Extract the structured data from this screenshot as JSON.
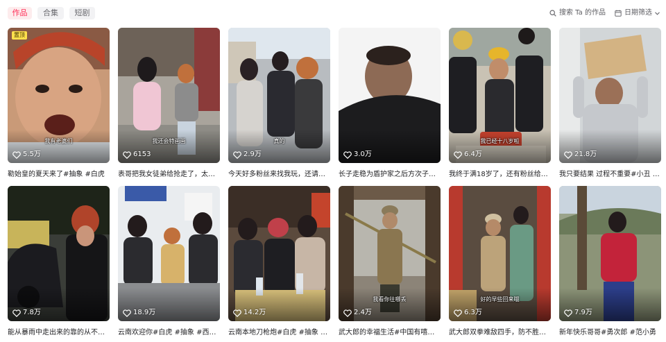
{
  "tabs": [
    {
      "label": "作品",
      "active": true
    },
    {
      "label": "合集",
      "active": false
    },
    {
      "label": "短剧",
      "active": false
    }
  ],
  "toolbar": {
    "search_label": "搜索 Ta 的作品",
    "search_icon": "search-icon",
    "date_filter_label": "日期筛选",
    "date_icon": "calendar-icon",
    "dropdown_icon": "chevron-down-icon"
  },
  "colors": {
    "accent": "#fe2c55",
    "pin_badge": "#ffe14d"
  },
  "videos": [
    {
      "pinned": true,
      "pin_label": "置顶",
      "subtitle": "我有老婆们",
      "likes": "5.5万",
      "caption": "勒始皇的夏天来了#抽象 #白虎"
    },
    {
      "pinned": false,
      "subtitle": "我还会特画画",
      "likes": "6153",
      "caption": "表哥把我女徒弟给抢走了，太…"
    },
    {
      "pinned": false,
      "subtitle": "真的",
      "likes": "2.9万",
      "caption": "今天好多粉丝来找我玩，还请…"
    },
    {
      "pinned": false,
      "subtitle": "",
      "likes": "3.0万",
      "caption": "长子走稳为盾护家之后方次子…"
    },
    {
      "pinned": false,
      "subtitle": "我已经十八岁啦",
      "likes": "6.4万",
      "caption": "我终于满18岁了，还有粉丝给…"
    },
    {
      "pinned": false,
      "subtitle": "",
      "likes": "21.8万",
      "caption": "我只要结果 过程不重要#小丑 …"
    },
    {
      "pinned": false,
      "subtitle": "",
      "likes": "7.8万",
      "caption": "能从暴雨中走出来的靠的从不…"
    },
    {
      "pinned": false,
      "subtitle": "",
      "likes": "18.9万",
      "caption": "云南欢迎你#白虎 #抽象 #西格…"
    },
    {
      "pinned": false,
      "subtitle": "",
      "likes": "14.2万",
      "caption": "云南本地刀枪炮#白虎 #抽象 #…"
    },
    {
      "pinned": false,
      "subtitle": "我看你往哪丢",
      "likes": "2.4万",
      "caption": "武大郎的幸福生活#中国有嘻哈…"
    },
    {
      "pinned": false,
      "subtitle": "好的早些回来哦",
      "likes": "6.3万",
      "caption": "武大郎双拳难敌四手，防不胜…"
    },
    {
      "pinned": false,
      "subtitle": "",
      "likes": "7.9万",
      "caption": "新年快乐哥哥#勇次郎 #范小勇"
    }
  ]
}
